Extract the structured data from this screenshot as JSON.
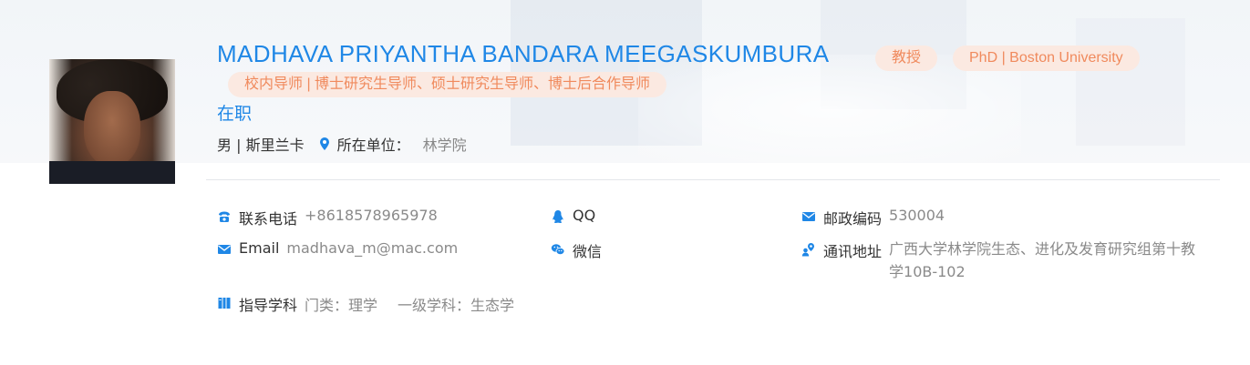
{
  "profile": {
    "name": "MADHAVA PRIYANTHA BANDARA MEEGASKUMBURA",
    "title_tag": "教授",
    "degree_tag": "PhD | Boston University",
    "roles_tag": "校内导师 | 博士研究生导师、硕士研究生导师、博士后合作导师",
    "status": "在职",
    "gender_country": "男 | 斯里兰卡",
    "unit_label": "所在单位：",
    "unit_value": "林学院"
  },
  "contact": {
    "phone_label": "联系电话",
    "phone_value": "+8618578965978",
    "email_label": "Email",
    "email_value": "madhava_m@mac.com",
    "qq_label": "QQ",
    "wechat_label": "微信",
    "zip_label": "邮政编码",
    "zip_value": "530004",
    "address_label": "通讯地址",
    "address_value": "广西大学林学院生态、进化及发育研究组第十教学10B-102"
  },
  "subject": {
    "label": "指导学科",
    "category": "门类：理学",
    "first_level": "一级学科：生态学"
  },
  "icons": {
    "phone": "phone-icon",
    "email": "mail-icon",
    "qq": "qq-penguin-icon",
    "wechat": "wechat-icon",
    "zip": "mail-icon",
    "address": "address-icon",
    "subject": "book-icon",
    "location": "location-pin-icon"
  },
  "colors": {
    "accent": "#1f87e6",
    "tag_text": "#f08a5d",
    "tag_bg": "#fbe9e1"
  }
}
